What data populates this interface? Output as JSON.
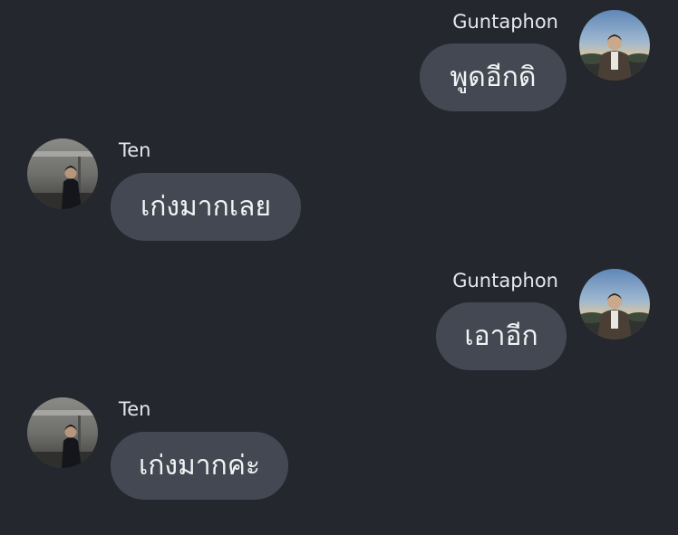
{
  "messages": [
    {
      "sender": "Guntaphon",
      "side": "right",
      "text": "พูดอีกดิ",
      "avatar_icon": "guntaphon-avatar"
    },
    {
      "sender": "Ten",
      "side": "left",
      "text": "เก่งมากเลย",
      "avatar_icon": "ten-avatar"
    },
    {
      "sender": "Guntaphon",
      "side": "right",
      "text": "เอาอีก",
      "avatar_icon": "guntaphon-avatar"
    },
    {
      "sender": "Ten",
      "side": "left",
      "text": "เก่งมากค่ะ",
      "avatar_icon": "ten-avatar"
    }
  ],
  "colors": {
    "background": "#24272e",
    "bubble": "#444852",
    "text": "#f2f3f5"
  }
}
